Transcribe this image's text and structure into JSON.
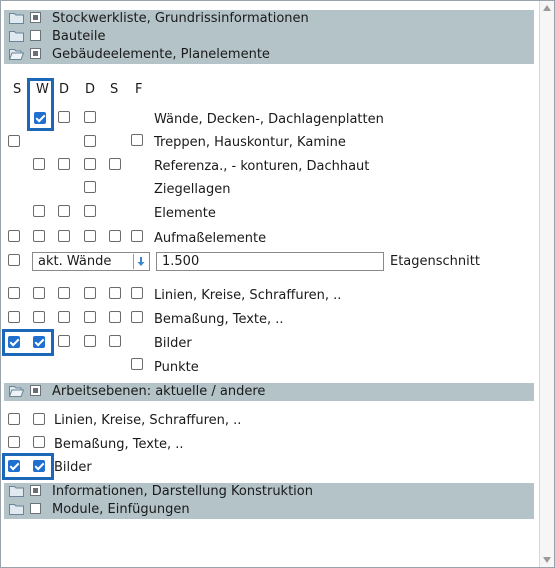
{
  "sections": {
    "stockwerk": "Stockwerkliste, Grundrissinformationen",
    "bauteile": "Bauteile",
    "gebaeude": "Gebäudeelemente, Planelemente",
    "arbeitsebenen": "Arbeitsebenen: aktuelle / andere",
    "informationen": "Informationen, Darstellung Konstruktion",
    "module": "Module, Einfügungen"
  },
  "columns": [
    "S",
    "W",
    "D",
    "D",
    "S",
    "F"
  ],
  "rows": {
    "waende": "Wände, Decken-, Dachlagenplatten",
    "treppen": "Treppen, Hauskontur, Kamine",
    "referenz": "Referenza., - konturen, Dachhaut",
    "ziegel": "Ziegellagen",
    "elemente": "Elemente",
    "aufmass": "Aufmaßelemente",
    "linien": "Linien, Kreise, Schraffuren, ..",
    "bemassung": "Bemaßung, Texte, ..",
    "bilder": "Bilder",
    "punkte": "Punkte"
  },
  "etagen": {
    "select_value": "akt. Wände",
    "input_value": "1.500",
    "label": "Etagenschnitt"
  },
  "arbeits": {
    "linien": "Linien, Kreise, Schraffuren, ..",
    "bemassung": "Bemaßung, Texte, ..",
    "bilder": "Bilder"
  },
  "colors": {
    "section_bg": "#b4c3c8",
    "checkbox_on": "#1f6fd0",
    "highlight": "#1b67b8"
  }
}
